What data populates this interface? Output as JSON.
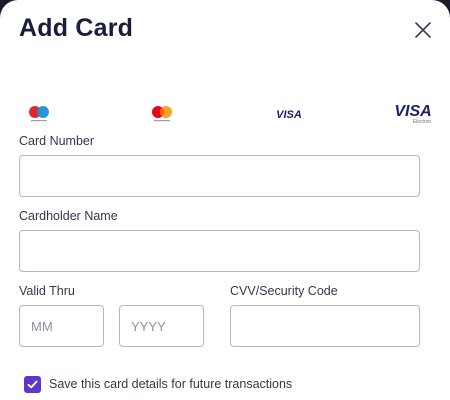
{
  "modal": {
    "title": "Add Card"
  },
  "card_brands": [
    {
      "name": "Maestro",
      "icon": "maestro-logo-icon"
    },
    {
      "name": "Mastercard",
      "icon": "mastercard-logo-icon"
    },
    {
      "name": "VISA",
      "icon": "visa-logo-icon"
    },
    {
      "name": "VISA Electron",
      "icon": "visa-electron-logo-icon",
      "text": "VISA",
      "subtext": "Electron"
    }
  ],
  "form": {
    "card_number": {
      "label": "Card Number",
      "value": "",
      "placeholder": ""
    },
    "cardholder_name": {
      "label": "Cardholder Name",
      "value": "",
      "placeholder": ""
    },
    "valid_thru": {
      "label": "Valid Thru",
      "month": {
        "value": "",
        "placeholder": "MM"
      },
      "year": {
        "value": "",
        "placeholder": "YYYY"
      }
    },
    "cvv": {
      "label": "CVV/Security Code",
      "value": "",
      "placeholder": ""
    },
    "save_card": {
      "label": "Save this card details for future transactions",
      "checked": true
    }
  },
  "colors": {
    "title": "#1a1e3a",
    "accent": "#5b38c6",
    "border": "#b5b7c4",
    "visa_blue": "#1a1f71"
  }
}
